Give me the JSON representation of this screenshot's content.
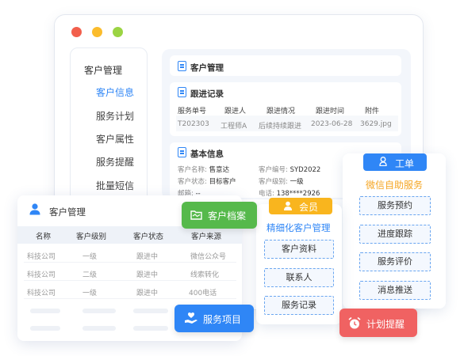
{
  "window": {
    "dots": [
      "#f25f4c",
      "#fbbc2c",
      "#9bd443"
    ]
  },
  "sidebar": {
    "title": "客户管理",
    "items": [
      {
        "label": "客户信息",
        "active": true
      },
      {
        "label": "服务计划"
      },
      {
        "label": "客户属性"
      },
      {
        "label": "服务提醒"
      },
      {
        "label": "批量短信"
      }
    ]
  },
  "main": {
    "title": "客户管理",
    "followup": {
      "title": "跟进记录",
      "headers": [
        "服务单号",
        "跟进人",
        "跟进情况",
        "跟进时间",
        "附件"
      ],
      "row": [
        "T202303",
        "工程师A",
        "后续持续跟进",
        "2023-06-28",
        "3629.jpg"
      ]
    },
    "basic": {
      "title": "基本信息",
      "fields": [
        {
          "label": "客户名称:",
          "value": "售意达"
        },
        {
          "label": "客户编号:",
          "value": "SYD2022"
        },
        {
          "label": "客户状态:",
          "value": "目标客户"
        },
        {
          "label": "客户级别:",
          "value": "一级"
        },
        {
          "label": "邮箱:",
          "value": "--"
        },
        {
          "label": "电话:",
          "value": "138****2926"
        }
      ]
    }
  },
  "float_card": {
    "title": "客户管理",
    "headers": [
      "名称",
      "客户级别",
      "客户状态",
      "客户来源"
    ],
    "rows": [
      [
        "科技公司",
        "一级",
        "跟进中",
        "微信公众号"
      ],
      [
        "科技公司",
        "二级",
        "跟进中",
        "线索转化"
      ],
      [
        "科技公司",
        "一级",
        "跟进中",
        "400电话"
      ]
    ]
  },
  "badges": {
    "archive": "客户档案",
    "service_items": "服务项目",
    "plan_reminder": "计划提醒"
  },
  "member_card": {
    "tag": "会员",
    "title": "精细化客户管理",
    "items": [
      "客户资料",
      "联系人",
      "服务记录"
    ]
  },
  "ticket_card": {
    "tag": "工单",
    "title": "微信自助服务",
    "items": [
      "服务预约",
      "进度跟踪",
      "服务评价",
      "消息推送"
    ]
  },
  "colors": {
    "accent": "#2f86f6",
    "green": "#56b94b",
    "orange_title": "#f5a623",
    "red": "#f06262",
    "member_tag": "#f9b51e"
  }
}
